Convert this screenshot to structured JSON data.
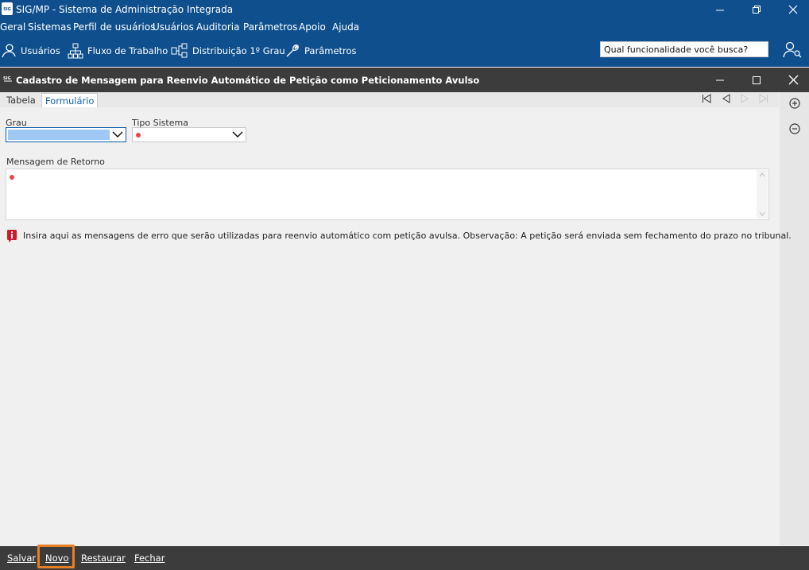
{
  "app": {
    "title": "SIG/MP - Sistema de Administração Integrada",
    "logo_text": "SIG"
  },
  "menu": [
    "Geral",
    "Sistemas",
    "Perfil de usuários",
    "Usuários",
    "Auditoria",
    "Parâmetros",
    "Apoio",
    "Ajuda"
  ],
  "toolbar": {
    "items": [
      "Usuários",
      "Fluxo de Trabalho",
      "Distribuição 1º Grau",
      "Parâmetros"
    ],
    "search_placeholder": "Qual funcionalidade você busca?"
  },
  "subwindow": {
    "title": "Cadastro de Mensagem para Reenvio Automático de Petição como Peticionamento Avulso"
  },
  "tabs": [
    "Tabela",
    "Formulário"
  ],
  "form": {
    "grau_label": "Grau",
    "tipo_sistema_label": "Tipo Sistema",
    "mensagem_label": "Mensagem de Retorno",
    "info_text": "Insira aqui as mensagens de erro que serão utilizadas para reenvio automático com petição avulsa. Observação: A petição será enviada sem fechamento do prazo no tribunal."
  },
  "bottom": {
    "buttons": [
      "Salvar",
      "Novo",
      "Restaurar",
      "Fechar"
    ]
  },
  "colors": {
    "title_bar": "#0f4f8e",
    "dark_bar": "#3c3c3c",
    "highlight": "#e87e22",
    "required": "#e8474b"
  }
}
